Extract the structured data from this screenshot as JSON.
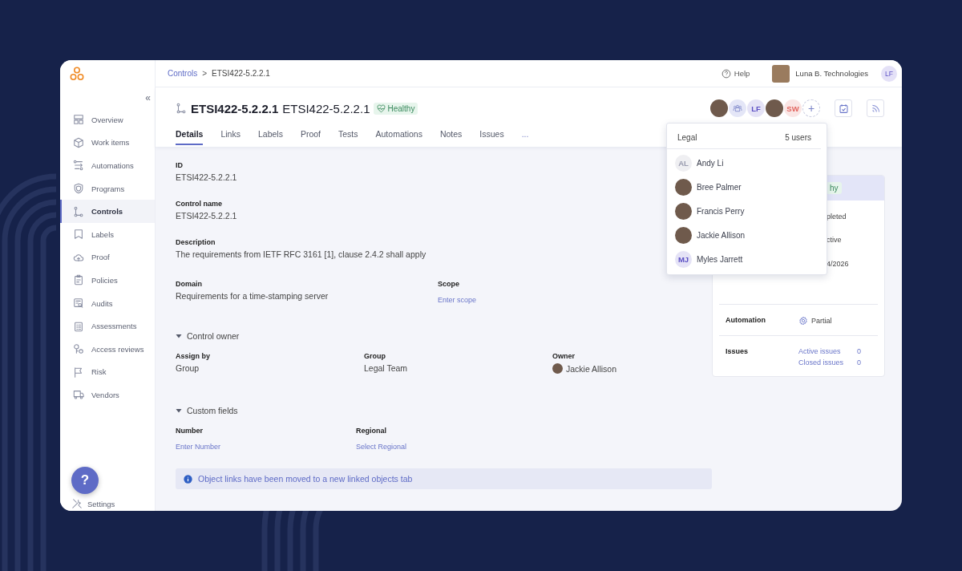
{
  "sidebar": {
    "collapse": "«",
    "items": [
      {
        "label": "Overview",
        "selected": false
      },
      {
        "label": "Work items",
        "selected": false
      },
      {
        "label": "Automations",
        "selected": false
      },
      {
        "label": "Programs",
        "selected": false
      },
      {
        "label": "Controls",
        "selected": true
      },
      {
        "label": "Labels",
        "selected": false
      },
      {
        "label": "Proof",
        "selected": false
      },
      {
        "label": "Policies",
        "selected": false
      },
      {
        "label": "Audits",
        "selected": false
      },
      {
        "label": "Assessments",
        "selected": false
      },
      {
        "label": "Access reviews",
        "selected": false
      },
      {
        "label": "Risk",
        "selected": false
      },
      {
        "label": "Vendors",
        "selected": false
      }
    ],
    "help_button": "?",
    "settings": "Settings"
  },
  "breadcrumb": {
    "parent": "Controls",
    "separator": ">",
    "current": "ETSI422-5.2.2.1"
  },
  "topbar": {
    "help": "Help",
    "organization": "Luna B. Technologies",
    "user_initials": "LF"
  },
  "header": {
    "code": "ETSI422-5.2.2.1",
    "name": "ETSI422-5.2.2.1",
    "status": "Healthy"
  },
  "assignees": [
    {
      "kind": "photo"
    },
    {
      "kind": "group"
    },
    {
      "kind": "initials",
      "initials": "LF",
      "color": "#5b4fc4"
    },
    {
      "kind": "photo"
    },
    {
      "kind": "initials",
      "initials": "SW",
      "color": "#e2645e"
    },
    {
      "kind": "add",
      "label": "+"
    }
  ],
  "tabs": [
    {
      "label": "Details",
      "selected": true
    },
    {
      "label": "Links",
      "selected": false
    },
    {
      "label": "Labels",
      "selected": false
    },
    {
      "label": "Proof",
      "selected": false
    },
    {
      "label": "Tests",
      "selected": false
    },
    {
      "label": "Automations",
      "selected": false
    },
    {
      "label": "Notes",
      "selected": false
    },
    {
      "label": "Issues",
      "selected": false
    },
    {
      "label": "...",
      "selected": false
    }
  ],
  "details": [
    {
      "label": "ID",
      "value": "ETSI422-5.2.2.1"
    },
    {
      "label": "Control name",
      "value": "ETSI422-5.2.2.1"
    },
    {
      "label": "Description",
      "value": "The requirements from IETF RFC 3161 [1], clause 2.4.2 shall apply"
    }
  ],
  "domain_row": [
    {
      "label": "Domain",
      "kind": "text",
      "value": "Requirements for a time-stamping server"
    },
    {
      "label": "Scope",
      "kind": "action",
      "value": "Enter scope"
    }
  ],
  "sections": [
    {
      "title": "Control owner",
      "expanded": true,
      "fields": [
        {
          "label": "Assign by",
          "kind": "text",
          "value": "Group"
        },
        {
          "label": "Group",
          "kind": "text",
          "value": "Legal Team"
        },
        {
          "label": "Owner",
          "kind": "person",
          "value": "Jackie Allison"
        }
      ]
    },
    {
      "title": "Custom fields",
      "expanded": true,
      "fields": [
        {
          "label": "Number",
          "kind": "action",
          "value": "Enter Number"
        },
        {
          "label": "Regional",
          "kind": "action",
          "value": "Select Regional"
        }
      ]
    }
  ],
  "info_banner": "Object links have been moved to a new linked objects tab",
  "summary_card": {
    "status": "hy",
    "rows": [
      "pleted",
      "ctive",
      "4/2026"
    ],
    "automation": {
      "label": "Automation",
      "value": "Partial"
    },
    "issues": {
      "label": "Issues",
      "links": [
        {
          "label": "Active issues",
          "count": "0"
        },
        {
          "label": "Closed issues",
          "count": "0"
        }
      ]
    }
  },
  "popover": {
    "title": "Legal",
    "count": "5 users",
    "users": [
      {
        "name": "Andy Li",
        "kind": "initials",
        "initials": "AL",
        "color": "#9a9caf"
      },
      {
        "name": "Bree Palmer",
        "kind": "photo"
      },
      {
        "name": "Francis Perry",
        "kind": "photo"
      },
      {
        "name": "Jackie Allison",
        "kind": "photo"
      },
      {
        "name": "Myles Jarrett",
        "kind": "initials",
        "initials": "MJ",
        "color": "#5b4fc4"
      }
    ]
  }
}
